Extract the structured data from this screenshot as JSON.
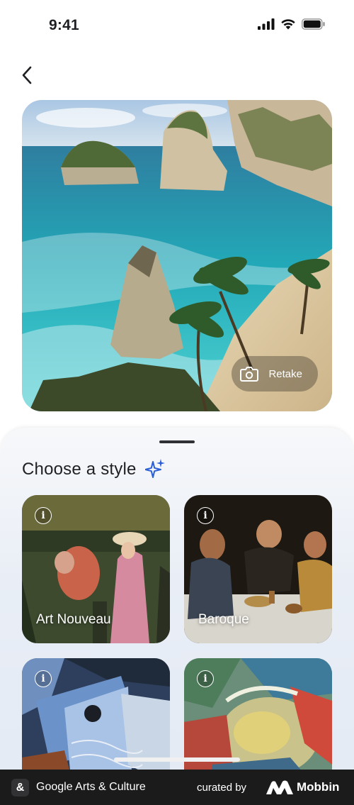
{
  "status_bar": {
    "time": "9:41",
    "icons": [
      "cellular-signal-icon",
      "wifi-icon",
      "battery-icon"
    ]
  },
  "navigation": {
    "back_icon": "chevron-left-icon"
  },
  "photo": {
    "retake_label": "Retake",
    "retake_icon": "camera-icon"
  },
  "style_sheet": {
    "title": "Choose a style",
    "title_icon": "sparkle-icon",
    "styles": [
      {
        "label": "Art Nouveau",
        "info_icon": "info-icon"
      },
      {
        "label": "Baroque",
        "info_icon": "info-icon"
      },
      {
        "label": "",
        "info_icon": "info-icon"
      },
      {
        "label": "",
        "info_icon": "info-icon"
      }
    ]
  },
  "footer": {
    "app_icon_glyph": "&",
    "app_name": "Google Arts & Culture",
    "curated_by": "curated by",
    "brand": "Mobbin"
  },
  "colors": {
    "sparkle_accent": "#2a5fd6",
    "sheet_background": "#e6ecf5",
    "footer_background": "#1b1b1c"
  }
}
